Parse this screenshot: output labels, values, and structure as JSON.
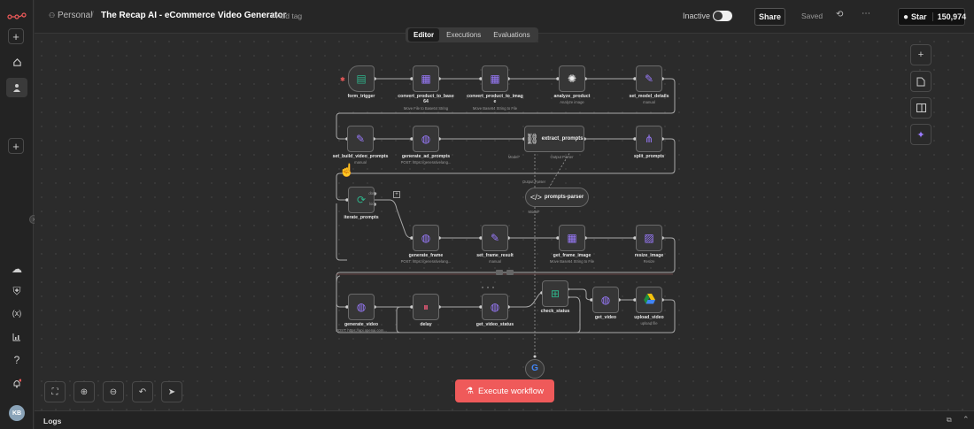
{
  "header": {
    "owner": "Personal",
    "workflow_name": "The Recap AI - eCommerce Video Generator",
    "add_tag": "+ Add tag",
    "status_label": "Inactive",
    "share_label": "Share",
    "saved_label": "Saved",
    "star_label": "Star",
    "star_count": "150,974"
  },
  "tabs": [
    "Editor",
    "Executions",
    "Evaluations"
  ],
  "nodes": {
    "form_trigger": {
      "label": "form_trigger",
      "sub": ""
    },
    "convert_product_to_base64": {
      "label": "convert_product_to_base\n64",
      "sub": "Move File to Base64 String"
    },
    "convert_product_to_image": {
      "label": "convert_product_to_imag\ne",
      "sub": "Move Base64 String to File"
    },
    "analyze_product": {
      "label": "analyze_product",
      "sub": "Analyze image"
    },
    "set_model_details": {
      "label": "set_model_details",
      "sub": "manual"
    },
    "set_build_video_prompts": {
      "label": "set_build_video_prompts",
      "sub": "manual"
    },
    "generate_ad_prompts": {
      "label": "generate_ad_prompts",
      "sub": "POST: https://generativelang..."
    },
    "extract_prompts": {
      "label": "extract_prompts",
      "sub": ""
    },
    "split_prompts": {
      "label": "split_prompts",
      "sub": ""
    },
    "prompts_parser": {
      "label": "prompts-parser",
      "sub": ""
    },
    "iterate_prompts": {
      "label": "iterate_prompts",
      "sub": ""
    },
    "generate_frame": {
      "label": "generate_frame",
      "sub": "POST: https://generativelang..."
    },
    "set_frame_result": {
      "label": "set_frame_result",
      "sub": "manual"
    },
    "get_frame_image": {
      "label": "get_frame_image",
      "sub": "Move Base64 String to File"
    },
    "resize_image": {
      "label": "resize_image",
      "sub": "Resize"
    },
    "generate_video": {
      "label": "generate_video",
      "sub": "POST: https://api.openai.com..."
    },
    "delay": {
      "label": "delay",
      "sub": ""
    },
    "get_video_status": {
      "label": "get_video_status",
      "sub": ""
    },
    "check_status": {
      "label": "check_status",
      "sub": ""
    },
    "get_video": {
      "label": "get_video",
      "sub": ""
    },
    "upload_video": {
      "label": "upload_video",
      "sub": "upload file"
    }
  },
  "port_labels": {
    "model": "Model*",
    "output_parser": "Output Parser",
    "done": "done",
    "loop": "loop"
  },
  "execute_label": "Execute workflow",
  "logs_label": "Logs",
  "user_initials": "KB",
  "colors": {
    "accent": "#ef5a5a",
    "node_border": "#6a6a6a",
    "edge": "#a8a8a8",
    "purple_icon": "#9b7bff",
    "green_icon": "#2fb38a"
  }
}
